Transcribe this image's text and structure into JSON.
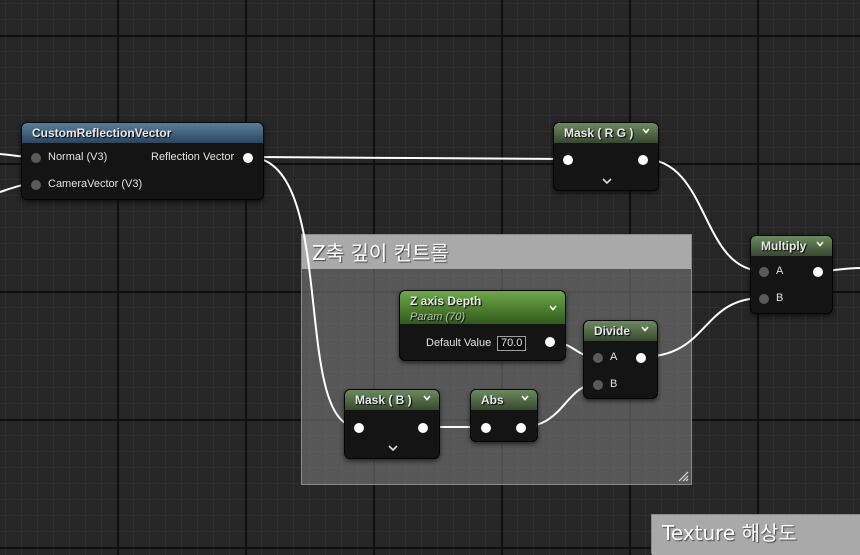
{
  "comments": {
    "z_depth_title": "Z축 깊이 컨트롤",
    "texture_title": "Texture 해상도"
  },
  "nodes": {
    "custom_reflection": {
      "title": "CustomReflectionVector",
      "inputs": [
        "Normal (V3)",
        "CameraVector (V3)"
      ],
      "output": "Reflection Vector"
    },
    "mask_rg": {
      "title": "Mask ( R G )"
    },
    "multiply": {
      "title": "Multiply",
      "inputs": [
        "A",
        "B"
      ]
    },
    "z_axis_depth": {
      "title": "Z axis Depth",
      "subtitle": "Param (70)",
      "default_label": "Default Value",
      "default_value": "70.0"
    },
    "divide": {
      "title": "Divide",
      "inputs": [
        "A",
        "B"
      ]
    },
    "mask_b": {
      "title": "Mask ( B )"
    },
    "abs": {
      "title": "Abs"
    }
  },
  "icons": [
    "chevron-down-icon",
    "expand-arrow-icon",
    "resize-grip-icon",
    "pin-icon"
  ],
  "colors": {
    "graph_bg": "#262626",
    "function_header": "#5b7d9a",
    "math_header": "#6c8a60",
    "param_header": "#6fa84a",
    "wire": "#ffffff"
  }
}
